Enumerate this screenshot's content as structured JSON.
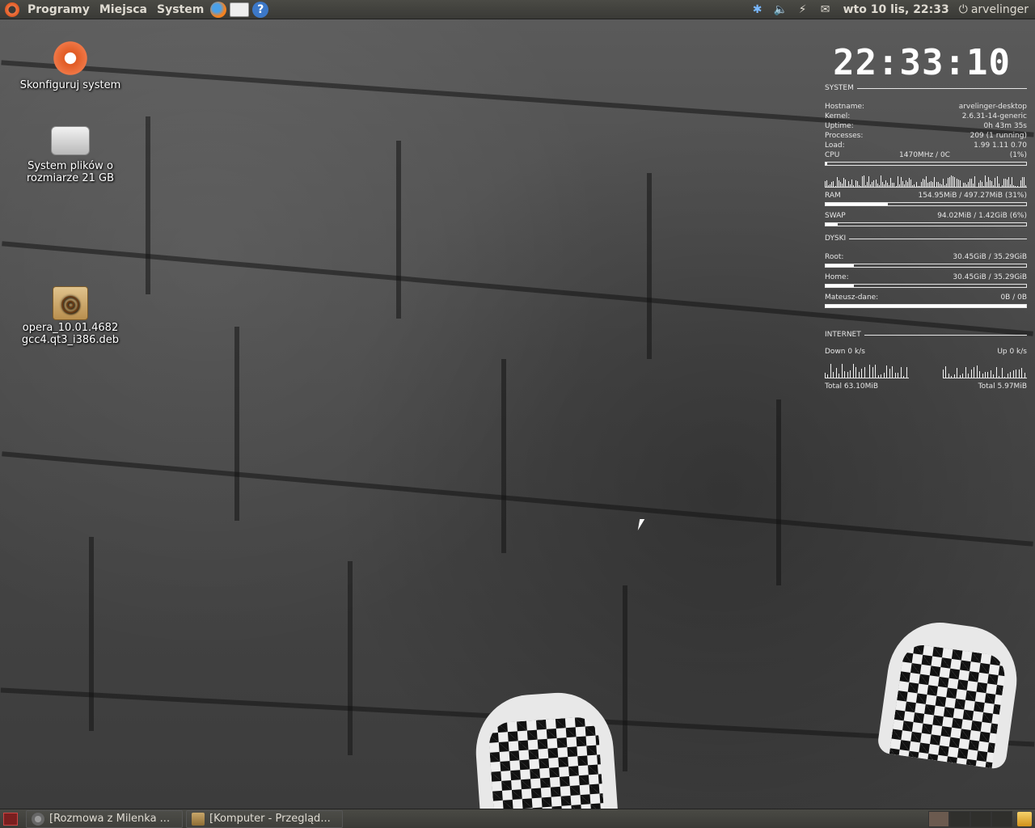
{
  "top_panel": {
    "menus": [
      "Programy",
      "Miejsca",
      "System"
    ],
    "clock": "wto 10 lis, 22:33",
    "user": "arvelinger"
  },
  "desktop_icons": [
    {
      "label": "Skonfiguruj system"
    },
    {
      "label": "System plików o rozmiarze 21 GB"
    },
    {
      "label": "opera_10.01.4682 gcc4.qt3_i386.deb"
    }
  ],
  "conky": {
    "time": "22:33:10",
    "system_header": "SYSTEM",
    "hostname_label": "Hostname:",
    "hostname": "arvelinger-desktop",
    "kernel_label": "Kernel:",
    "kernel": "2.6.31-14-generic",
    "uptime_label": "Uptime:",
    "uptime": "0h 43m 35s",
    "processes_label": "Processes:",
    "processes": "209 (1 running)",
    "load_label": "Load:",
    "load": "1.99 1.11 0.70",
    "cpu_label": "CPU",
    "cpu_freq": "1470MHz / 0C",
    "cpu_pct": "(1%)",
    "cpu_fraction": 0.01,
    "ram_label": "RAM",
    "ram": "154.95MiB / 497.27MiB (31%)",
    "ram_fraction": 0.31,
    "swap_label": "SWAP",
    "swap": "94.02MiB / 1.42GiB (6%)",
    "swap_fraction": 0.06,
    "disks_header": "DYSKI",
    "root_label": "Root:",
    "root": "30.45GiB / 35.29GiB",
    "root_fraction": 0.14,
    "home_label": "Home:",
    "home": "30.45GiB / 35.29GiB",
    "home_fraction": 0.14,
    "data_label": "Mateusz-dane:",
    "data": "0B / 0B",
    "data_fraction": 1.0,
    "internet_header": "INTERNET",
    "down": "Down 0 k/s",
    "up": "Up 0 k/s",
    "total_down": "Total 63.10MiB",
    "total_up": "Total 5.97MiB"
  },
  "taskbar": {
    "tasks": [
      "[Rozmowa z Milenka ...",
      "[Komputer - Przegląd..."
    ]
  }
}
